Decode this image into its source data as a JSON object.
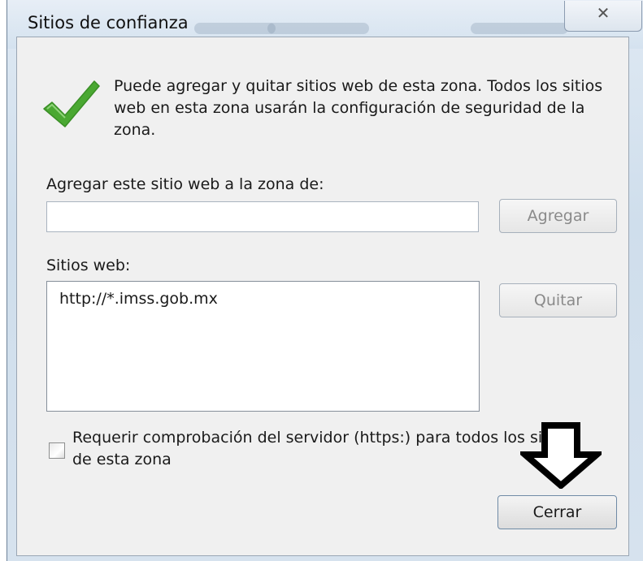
{
  "window": {
    "title": "Sitios de confianza",
    "close_glyph": "✕"
  },
  "info": {
    "icon": "checkmark-icon",
    "text": "Puede agregar y quitar sitios web de esta zona. Todos los sitios web en esta zona usarán la configuración de seguridad de la zona."
  },
  "add_site": {
    "label": "Agregar este sitio web a la zona de:",
    "value": "",
    "placeholder": "",
    "button_label": "Agregar"
  },
  "sites": {
    "label": "Sitios web:",
    "items": [
      "http://*.imss.gob.mx"
    ],
    "remove_button_label": "Quitar"
  },
  "https_requirement": {
    "label": "Requerir comprobación del servidor (https:) para todos los sitios de esta zona",
    "checked": false
  },
  "footer": {
    "close_button_label": "Cerrar"
  },
  "annotation": {
    "icon": "down-arrow-icon"
  },
  "colors": {
    "check_green": "#4aa832",
    "frame_blue": "#d4e2ef",
    "panel_bg": "#f0f0f0",
    "disabled_text": "#8a8a8a"
  }
}
